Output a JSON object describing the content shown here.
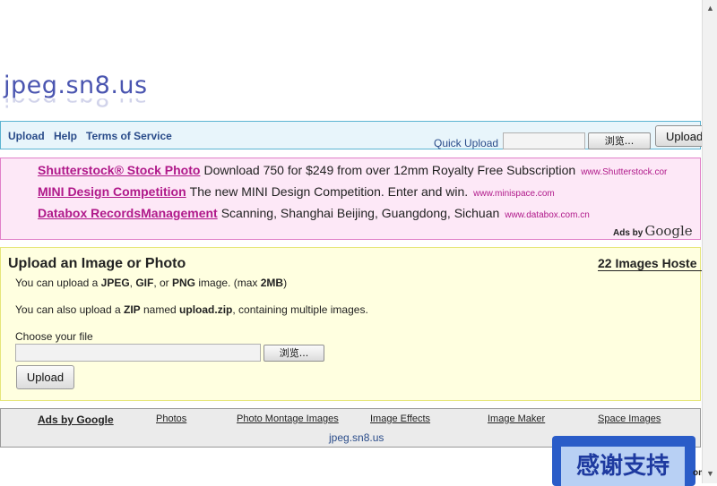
{
  "logo": {
    "text": "jpeg.sn8.us"
  },
  "nav": {
    "links": [
      "Upload",
      "Help",
      "Terms of Service"
    ],
    "quick_upload_label": "Quick Upload",
    "browse_label": "浏览...",
    "upload_button": "Upload"
  },
  "ads": {
    "items": [
      {
        "title": "Shutterstock® Stock Photo",
        "desc": "Download 750 for $249 from over 12mm Royalty Free Subscription",
        "url": "www.Shutterstock.cor"
      },
      {
        "title": "MINI Design Competition",
        "desc": "The new MINI Design Competition. Enter and win.",
        "url": "www.minispace.com"
      },
      {
        "title": "Databox RecordsManagement",
        "desc": "Scanning, Shanghai Beijing, Guangdong, Sichuan",
        "url": "www.databox.com.cn"
      }
    ],
    "ads_by": "Ads by",
    "google": "Google"
  },
  "upload_panel": {
    "title": "Upload an Image or Photo",
    "images_hosted": "22 Images Hoste",
    "line1_prefix": "You can upload a ",
    "fmt_jpeg": "JPEG",
    "sep1": ", ",
    "fmt_gif": "GIF",
    "sep2": ", or ",
    "fmt_png": "PNG",
    "line1_mid": " image. (max ",
    "max_size": "2MB",
    "line1_end": ")",
    "line2_prefix": "You can also upload a ",
    "zip": "ZIP",
    "line2_mid": " named ",
    "zip_name": "upload.zip",
    "line2_end": ", containing multiple images.",
    "choose_label": "Choose your file",
    "browse_label": "浏览...",
    "upload_button": "Upload"
  },
  "footer": {
    "ads_by_google": "Ads by Google",
    "links": [
      "Photos",
      "Photo Montage Images",
      "Image Effects",
      "Image Maker",
      "Space Images"
    ],
    "domain": "jpeg.sn8.us"
  },
  "badge": {
    "text": "感谢支持"
  },
  "corner": {
    "text": "om"
  }
}
